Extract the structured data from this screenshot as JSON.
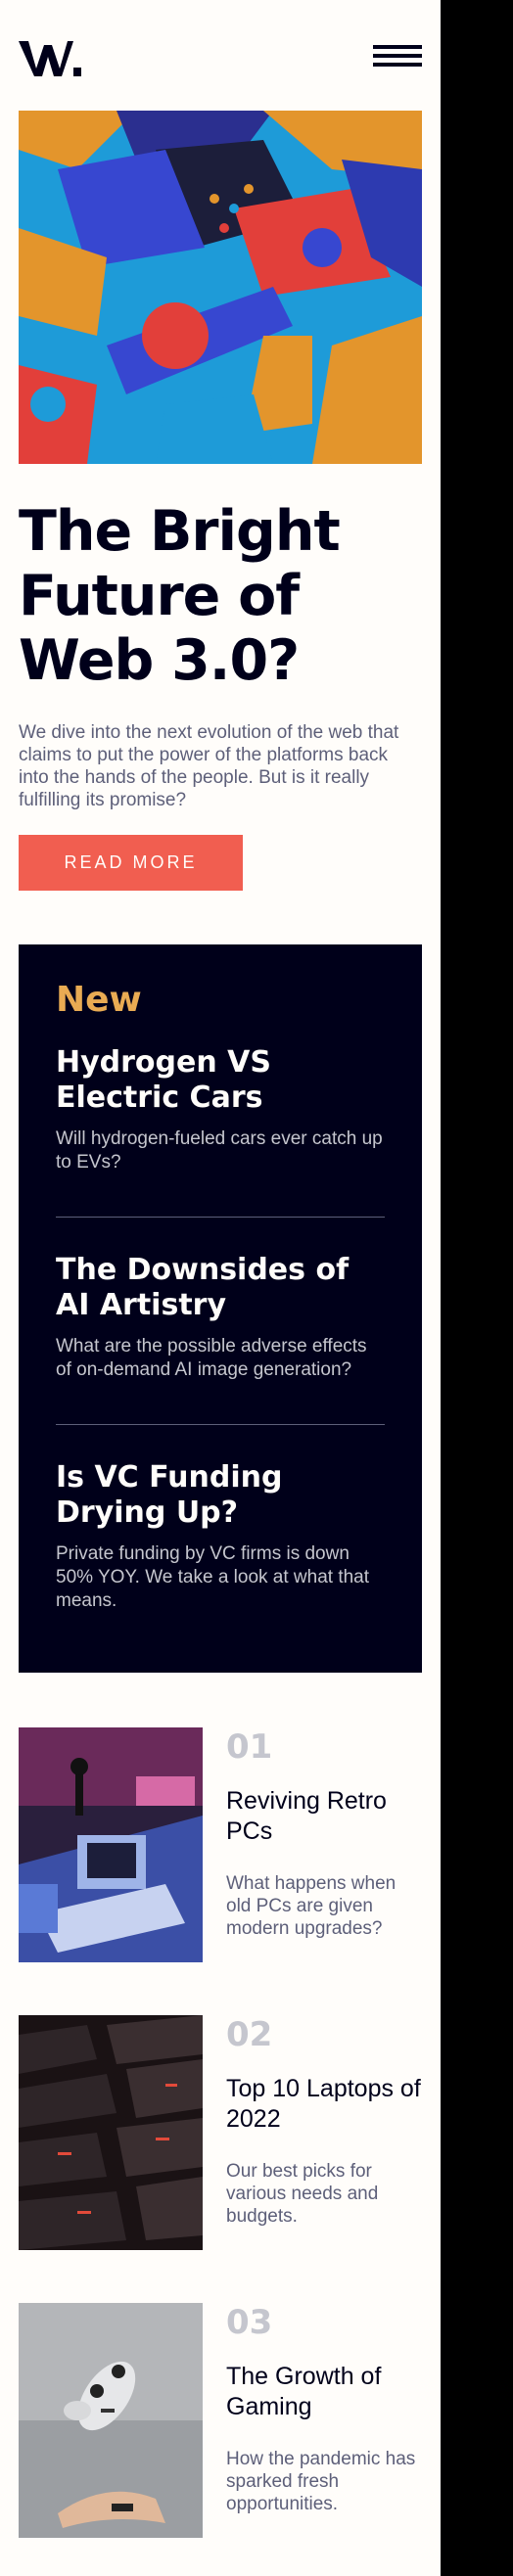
{
  "header": {
    "logo": "W.",
    "menu_icon": "hamburger-menu-icon"
  },
  "hero": {
    "title": "The Bright Future of Web 3.0?",
    "description": "We dive into the next evolution of the web that claims to put the power of the platforms back into the hands of the people. But is it really fulfilling its promise?",
    "button_label": "READ MORE"
  },
  "new_section": {
    "heading": "New",
    "items": [
      {
        "title": "Hydrogen VS Electric Cars",
        "description": "Will hydrogen-fueled cars ever catch up to EVs?"
      },
      {
        "title": "The Downsides of AI Artistry",
        "description": "What are the possible adverse effects of on-demand AI image generation?"
      },
      {
        "title": "Is VC Funding Drying Up?",
        "description": "Private funding by VC firms is down 50% YOY. We take a look at what that means."
      }
    ]
  },
  "articles": [
    {
      "number": "01",
      "title": "Reviving Retro PCs",
      "description": "What happens when old PCs are given modern upgrades?"
    },
    {
      "number": "02",
      "title": "Top 10 Laptops of 2022",
      "description": "Our best picks for various needs and budgets."
    },
    {
      "number": "03",
      "title": "The Growth of Gaming",
      "description": "How the pandemic has sparked fresh opportunities."
    }
  ],
  "colors": {
    "accent_red": "#f15e50",
    "accent_orange": "#e9ab53",
    "dark_navy": "#00001a",
    "off_white": "#fffdfa",
    "grayish_blue": "#5d5f79"
  }
}
